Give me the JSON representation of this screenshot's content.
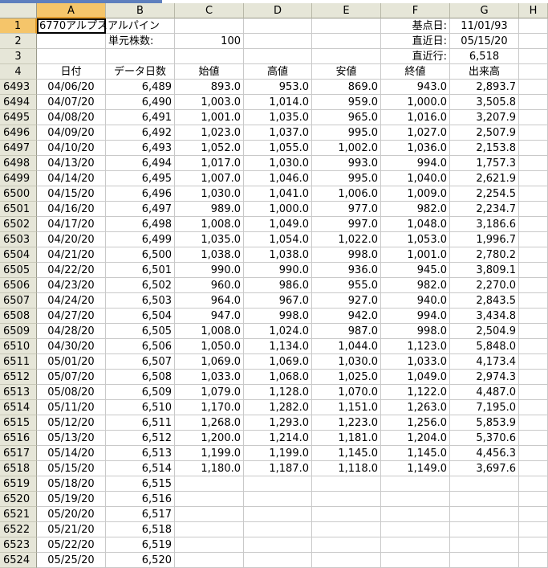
{
  "columns": [
    "A",
    "B",
    "C",
    "D",
    "E",
    "F",
    "G",
    "H"
  ],
  "info": {
    "r1": {
      "num": "1",
      "a": "6770アルプスアルパイン",
      "f": "基点日:",
      "g": "11/01/93"
    },
    "r2": {
      "num": "2",
      "b": "単元株数:",
      "c": "100",
      "f": "直近日:",
      "g": "05/15/20"
    },
    "r3": {
      "num": "3",
      "f": "直近行:",
      "g": "6,518"
    },
    "r4": {
      "num": "4",
      "a": "日付",
      "b": "データ日数",
      "c": "始値",
      "d": "高値",
      "e": "安値",
      "f": "終値",
      "g": "出来高"
    }
  },
  "rows": [
    [
      "6493",
      "04/06/20",
      "6,489",
      "893.0",
      "953.0",
      "869.0",
      "943.0",
      "2,893.7"
    ],
    [
      "6494",
      "04/07/20",
      "6,490",
      "1,003.0",
      "1,014.0",
      "959.0",
      "1,000.0",
      "3,505.8"
    ],
    [
      "6495",
      "04/08/20",
      "6,491",
      "1,001.0",
      "1,035.0",
      "965.0",
      "1,016.0",
      "3,207.9"
    ],
    [
      "6496",
      "04/09/20",
      "6,492",
      "1,023.0",
      "1,037.0",
      "995.0",
      "1,027.0",
      "2,507.9"
    ],
    [
      "6497",
      "04/10/20",
      "6,493",
      "1,052.0",
      "1,055.0",
      "1,002.0",
      "1,036.0",
      "2,153.8"
    ],
    [
      "6498",
      "04/13/20",
      "6,494",
      "1,017.0",
      "1,030.0",
      "993.0",
      "994.0",
      "1,757.3"
    ],
    [
      "6499",
      "04/14/20",
      "6,495",
      "1,007.0",
      "1,046.0",
      "995.0",
      "1,040.0",
      "2,621.9"
    ],
    [
      "6500",
      "04/15/20",
      "6,496",
      "1,030.0",
      "1,041.0",
      "1,006.0",
      "1,009.0",
      "2,254.5"
    ],
    [
      "6501",
      "04/16/20",
      "6,497",
      "989.0",
      "1,000.0",
      "977.0",
      "982.0",
      "2,234.7"
    ],
    [
      "6502",
      "04/17/20",
      "6,498",
      "1,008.0",
      "1,049.0",
      "997.0",
      "1,048.0",
      "3,186.6"
    ],
    [
      "6503",
      "04/20/20",
      "6,499",
      "1,035.0",
      "1,054.0",
      "1,022.0",
      "1,053.0",
      "1,996.7"
    ],
    [
      "6504",
      "04/21/20",
      "6,500",
      "1,038.0",
      "1,038.0",
      "998.0",
      "1,001.0",
      "2,780.2"
    ],
    [
      "6505",
      "04/22/20",
      "6,501",
      "990.0",
      "990.0",
      "936.0",
      "945.0",
      "3,809.1"
    ],
    [
      "6506",
      "04/23/20",
      "6,502",
      "960.0",
      "986.0",
      "955.0",
      "982.0",
      "2,270.0"
    ],
    [
      "6507",
      "04/24/20",
      "6,503",
      "964.0",
      "967.0",
      "927.0",
      "940.0",
      "2,843.5"
    ],
    [
      "6508",
      "04/27/20",
      "6,504",
      "947.0",
      "998.0",
      "942.0",
      "994.0",
      "3,434.8"
    ],
    [
      "6509",
      "04/28/20",
      "6,505",
      "1,008.0",
      "1,024.0",
      "987.0",
      "998.0",
      "2,504.9"
    ],
    [
      "6510",
      "04/30/20",
      "6,506",
      "1,050.0",
      "1,134.0",
      "1,044.0",
      "1,123.0",
      "5,848.0"
    ],
    [
      "6511",
      "05/01/20",
      "6,507",
      "1,069.0",
      "1,069.0",
      "1,030.0",
      "1,033.0",
      "4,173.4"
    ],
    [
      "6512",
      "05/07/20",
      "6,508",
      "1,033.0",
      "1,068.0",
      "1,025.0",
      "1,049.0",
      "2,974.3"
    ],
    [
      "6513",
      "05/08/20",
      "6,509",
      "1,079.0",
      "1,128.0",
      "1,070.0",
      "1,122.0",
      "4,487.0"
    ],
    [
      "6514",
      "05/11/20",
      "6,510",
      "1,170.0",
      "1,282.0",
      "1,151.0",
      "1,263.0",
      "7,195.0"
    ],
    [
      "6515",
      "05/12/20",
      "6,511",
      "1,268.0",
      "1,293.0",
      "1,223.0",
      "1,256.0",
      "5,853.9"
    ],
    [
      "6516",
      "05/13/20",
      "6,512",
      "1,200.0",
      "1,214.0",
      "1,181.0",
      "1,204.0",
      "5,370.6"
    ],
    [
      "6517",
      "05/14/20",
      "6,513",
      "1,199.0",
      "1,199.0",
      "1,145.0",
      "1,145.0",
      "4,456.3"
    ],
    [
      "6518",
      "05/15/20",
      "6,514",
      "1,180.0",
      "1,187.0",
      "1,118.0",
      "1,149.0",
      "3,697.6"
    ],
    [
      "6519",
      "05/18/20",
      "6,515",
      "",
      "",
      "",
      "",
      ""
    ],
    [
      "6520",
      "05/19/20",
      "6,516",
      "",
      "",
      "",
      "",
      ""
    ],
    [
      "6521",
      "05/20/20",
      "6,517",
      "",
      "",
      "",
      "",
      ""
    ],
    [
      "6522",
      "05/21/20",
      "6,518",
      "",
      "",
      "",
      "",
      ""
    ],
    [
      "6523",
      "05/22/20",
      "6,519",
      "",
      "",
      "",
      "",
      ""
    ],
    [
      "6524",
      "05/25/20",
      "6,520",
      "",
      "",
      "",
      "",
      ""
    ]
  ]
}
